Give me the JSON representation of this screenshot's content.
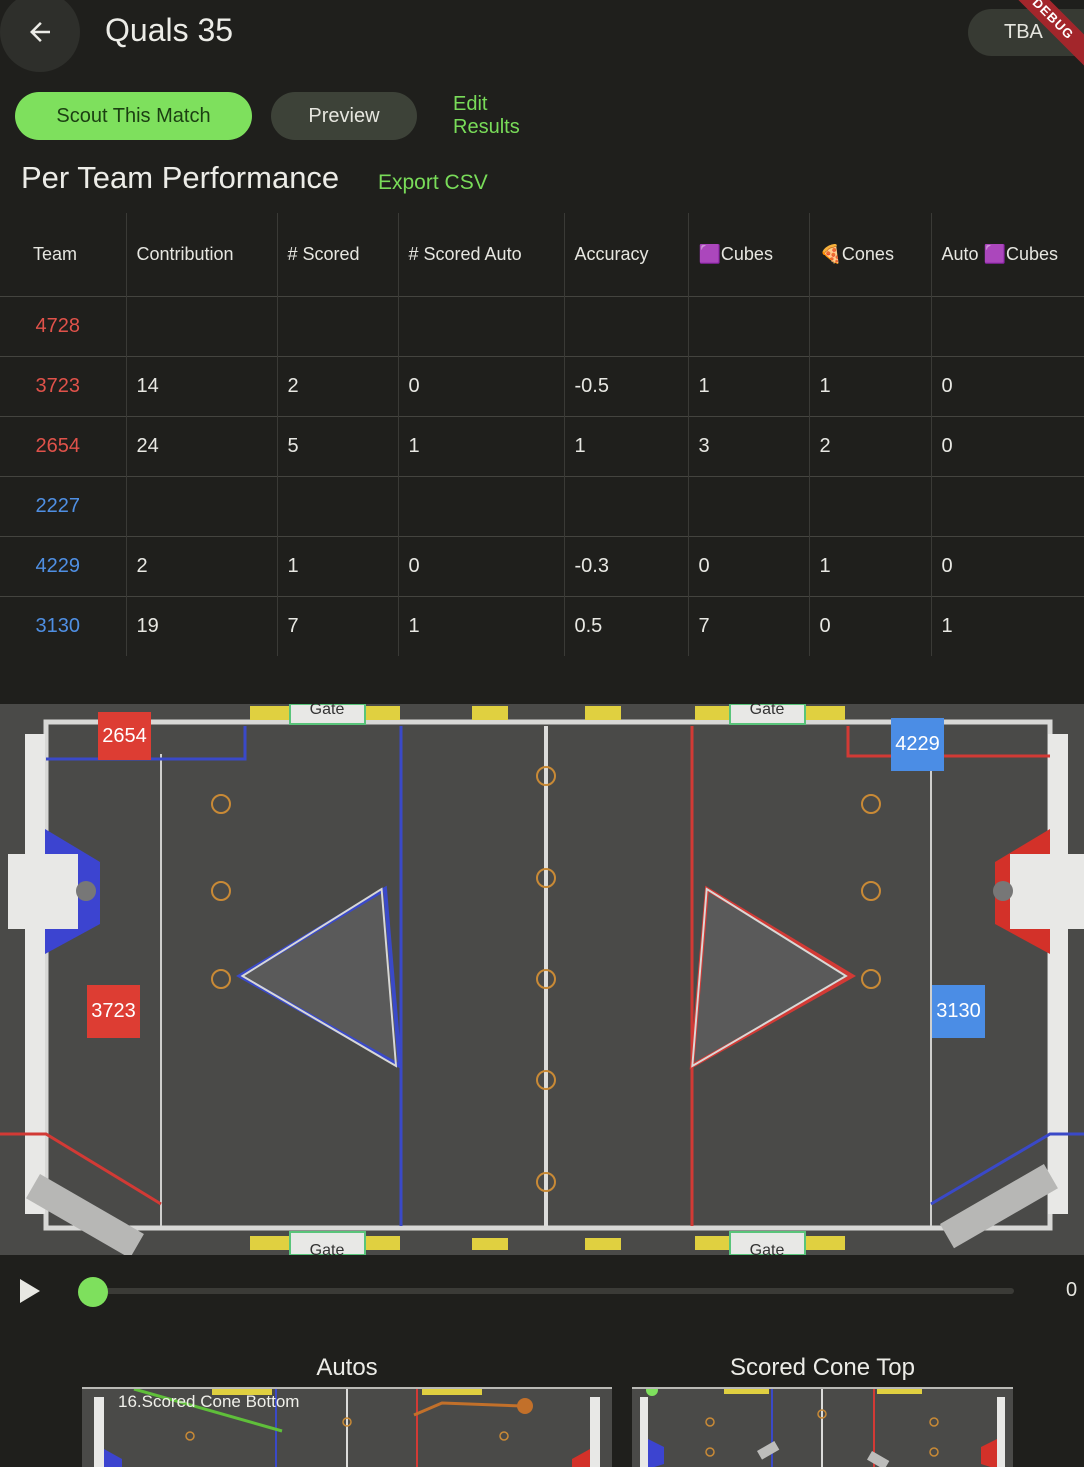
{
  "appbar": {
    "back_icon": "arrow-back-icon",
    "title": "Quals 35",
    "tba_label": "TBA",
    "debug_label": "DEBUG"
  },
  "actions": {
    "scout_label": "Scout This Match",
    "preview_label": "Preview",
    "edit_label": "Edit Results"
  },
  "performance": {
    "title": "Per Team Performance",
    "export_label": "Export CSV",
    "columns": [
      "Team",
      "Contribution",
      "# Scored",
      "# Scored Auto",
      "Accuracy",
      "🟪Cubes",
      "🍕Cones",
      "Auto 🟪Cubes"
    ],
    "rows": [
      {
        "team": "4728",
        "alliance": "red",
        "contribution": "",
        "scored": "",
        "scored_auto": "",
        "accuracy": "",
        "cubes": "",
        "cones": "",
        "auto_cubes": ""
      },
      {
        "team": "3723",
        "alliance": "red",
        "contribution": "14",
        "scored": "2",
        "scored_auto": "0",
        "accuracy": "-0.5",
        "cubes": "1",
        "cones": "1",
        "auto_cubes": "0"
      },
      {
        "team": "2654",
        "alliance": "red",
        "contribution": "24",
        "scored": "5",
        "scored_auto": "1",
        "accuracy": "1",
        "cubes": "3",
        "cones": "2",
        "auto_cubes": "0"
      },
      {
        "team": "2227",
        "alliance": "blue",
        "contribution": "",
        "scored": "",
        "scored_auto": "",
        "accuracy": "",
        "cubes": "",
        "cones": "",
        "auto_cubes": ""
      },
      {
        "team": "4229",
        "alliance": "blue",
        "contribution": "2",
        "scored": "1",
        "scored_auto": "0",
        "accuracy": "-0.3",
        "cubes": "0",
        "cones": "1",
        "auto_cubes": "0"
      },
      {
        "team": "3130",
        "alliance": "blue",
        "contribution": "19",
        "scored": "7",
        "scored_auto": "1",
        "accuracy": "0.5",
        "cubes": "7",
        "cones": "0",
        "auto_cubes": "1"
      }
    ]
  },
  "field": {
    "gate_label": "Gate",
    "robots": [
      {
        "team": "2654",
        "alliance": "red"
      },
      {
        "team": "3723",
        "alliance": "red"
      },
      {
        "team": "4229",
        "alliance": "blue"
      },
      {
        "team": "3130",
        "alliance": "blue"
      }
    ]
  },
  "colors": {
    "accent_green": "#7ee05d",
    "red_alliance": "#dd3d33",
    "blue_alliance": "#4b8de5",
    "background": "#1f1f1c"
  },
  "player": {
    "play_icon": "play-icon",
    "time_value": "0",
    "progress": 0
  },
  "thumbnails": [
    {
      "title": "Autos",
      "label": "16.Scored Cone Bottom"
    },
    {
      "title": "Scored Cone Top",
      "label": ""
    }
  ]
}
